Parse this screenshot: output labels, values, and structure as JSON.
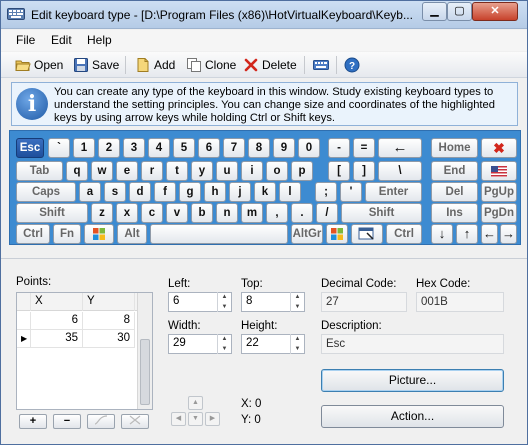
{
  "window": {
    "title": "Edit keyboard type - [D:\\Program Files (x86)\\HotVirtualKeyboard\\Keyb...",
    "min_glyph": "▁",
    "max_glyph": "▢",
    "close_glyph": "✕"
  },
  "menu": [
    "File",
    "Edit",
    "Help"
  ],
  "toolbar": {
    "open": "Open",
    "save": "Save",
    "add": "Add",
    "clone": "Clone",
    "delete": "Delete"
  },
  "info": {
    "icon_glyph": "i",
    "text": "You can create any type of the keyboard in this window. Study existing keyboard types to understand the setting principles. You can change size and coordinates of the highlighted keys by using arrow keys while holding Ctrl or Shift keys."
  },
  "keyboard": {
    "rows": [
      [
        "Esc",
        "`",
        "1",
        "2",
        "3",
        "4",
        "5",
        "6",
        "7",
        "8",
        "9",
        "0",
        "-",
        "=",
        "←"
      ],
      [
        "Tab",
        "q",
        "w",
        "e",
        "r",
        "t",
        "y",
        "u",
        "i",
        "o",
        "p",
        "[",
        "]",
        "\\"
      ],
      [
        "Caps",
        "a",
        "s",
        "d",
        "f",
        "g",
        "h",
        "j",
        "k",
        "l",
        ";",
        "'",
        "Enter"
      ],
      [
        "Shift",
        "z",
        "x",
        "c",
        "v",
        "b",
        "n",
        "m",
        ",",
        ".",
        "/",
        "Shift"
      ],
      [
        "Ctrl",
        "Fn",
        "",
        "Alt",
        "",
        "AltGr",
        "",
        "",
        "Ctrl"
      ]
    ],
    "side": [
      [
        "Home",
        "✖"
      ],
      [
        "End",
        ""
      ],
      [
        "Del",
        "PgUp"
      ],
      [
        "Ins",
        "PgDn"
      ],
      [
        "↓",
        "↑",
        "←",
        "→"
      ]
    ],
    "selected_key": "Esc"
  },
  "points": {
    "label": "Points:",
    "columns": [
      "X",
      "Y"
    ],
    "rows": [
      {
        "x": "6",
        "y": "8",
        "current": false
      },
      {
        "x": "35",
        "y": "30",
        "current": true
      }
    ],
    "add_label": "+",
    "remove_label": "−",
    "cursor_glyph": "▶"
  },
  "fields": {
    "left_label": "Left:",
    "left_value": "6",
    "top_label": "Top:",
    "top_value": "8",
    "width_label": "Width:",
    "width_value": "29",
    "height_label": "Height:",
    "height_value": "22",
    "decimal_label": "Decimal Code:",
    "decimal_value": "27",
    "hex_label": "Hex Code:",
    "hex_value": "001B",
    "desc_label": "Description:",
    "desc_value": "Esc",
    "x_readout": "X: 0",
    "y_readout": "Y: 0"
  },
  "buttons": {
    "picture": "Picture...",
    "action": "Action..."
  },
  "colors": {
    "keyboard_bg": "#3d8bd1",
    "selected_key": "#1e4f9c",
    "info_bg": "#eaf3fc"
  }
}
